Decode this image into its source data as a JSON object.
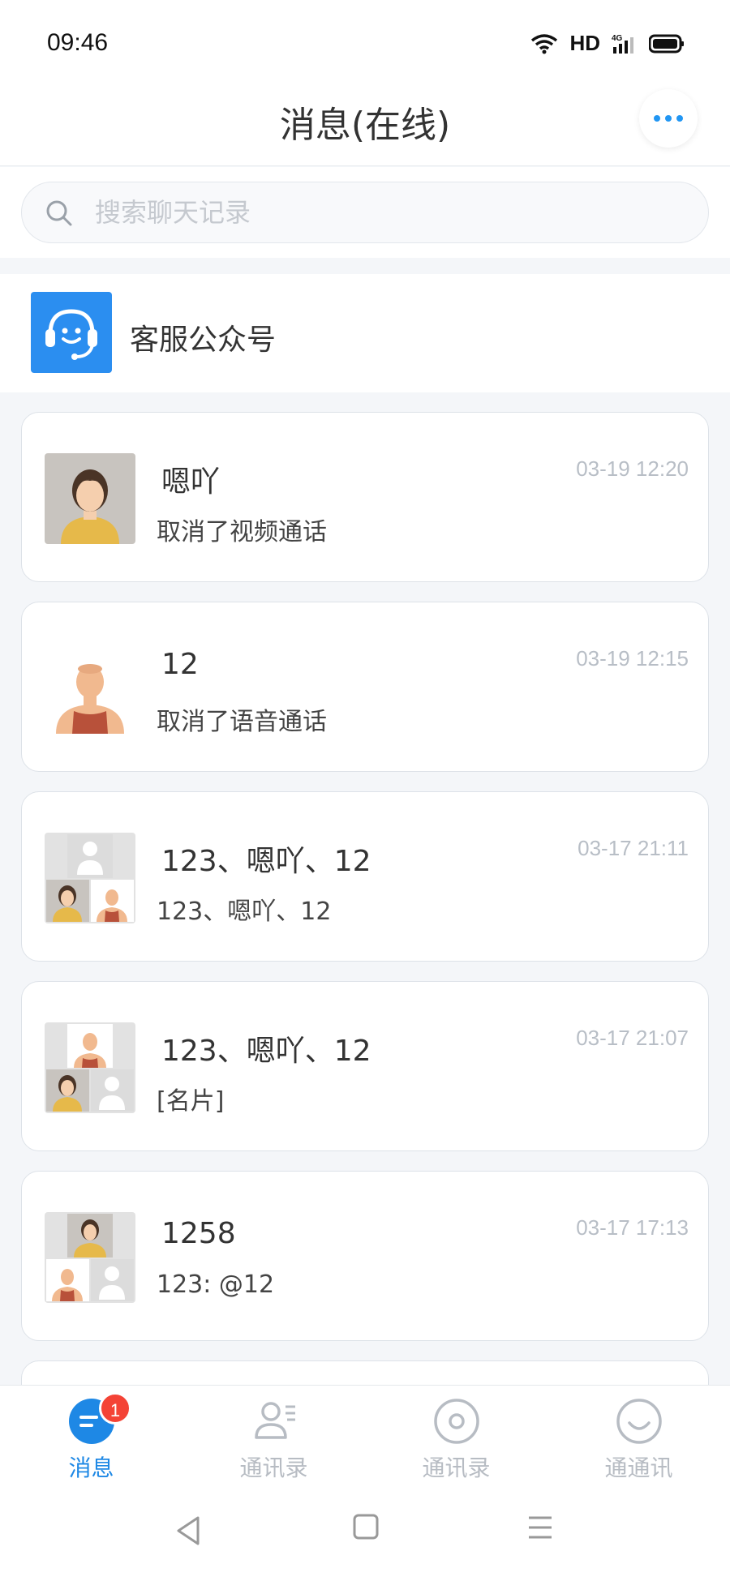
{
  "status": {
    "time": "09:46",
    "network": "HD",
    "signal_label": "4G"
  },
  "header": {
    "title": "消息(在线)",
    "more_icon": "more-dots-icon"
  },
  "search": {
    "placeholder": "搜索聊天记录"
  },
  "official": {
    "label": "客服公众号",
    "icon": "headset-icon",
    "color": "#2b8ef0"
  },
  "conversations": [
    {
      "name": "嗯吖",
      "preview": "取消了视频通话",
      "time": "03-19 12:20"
    },
    {
      "name": "12",
      "preview": "取消了语音通话",
      "time": "03-19 12:15"
    },
    {
      "name": "123、嗯吖、12",
      "preview": "123、嗯吖、12",
      "time": "03-17 21:11"
    },
    {
      "name": "123、嗯吖、12",
      "preview": "[名片]",
      "time": "03-17 21:07"
    },
    {
      "name": "1258",
      "preview": "123: @12",
      "time": "03-17 17:13"
    }
  ],
  "tabs": [
    {
      "label": "消息",
      "icon": "chat-icon",
      "badge": "1"
    },
    {
      "label": "通讯录",
      "icon": "contacts-icon"
    },
    {
      "label": "通讯录",
      "icon": "discover-icon"
    },
    {
      "label": "通通讯",
      "icon": "profile-icon"
    }
  ],
  "colors": {
    "accent": "#1e88e5",
    "badge": "#f44336"
  }
}
